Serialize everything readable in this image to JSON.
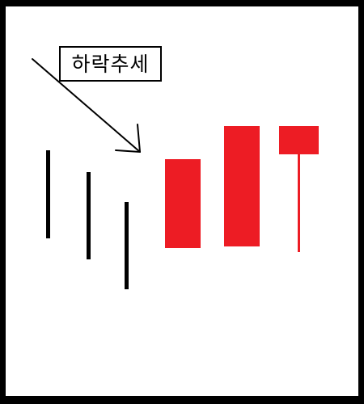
{
  "annotation": {
    "label": "하락추세"
  },
  "colors": {
    "background": "#ffffff",
    "border": "#000000",
    "prior_candles": "#000000",
    "arrow": "#000000",
    "bullish_candles": "#ed1c24"
  },
  "icons": {
    "arrow": "downtrend-arrow-icon"
  }
}
